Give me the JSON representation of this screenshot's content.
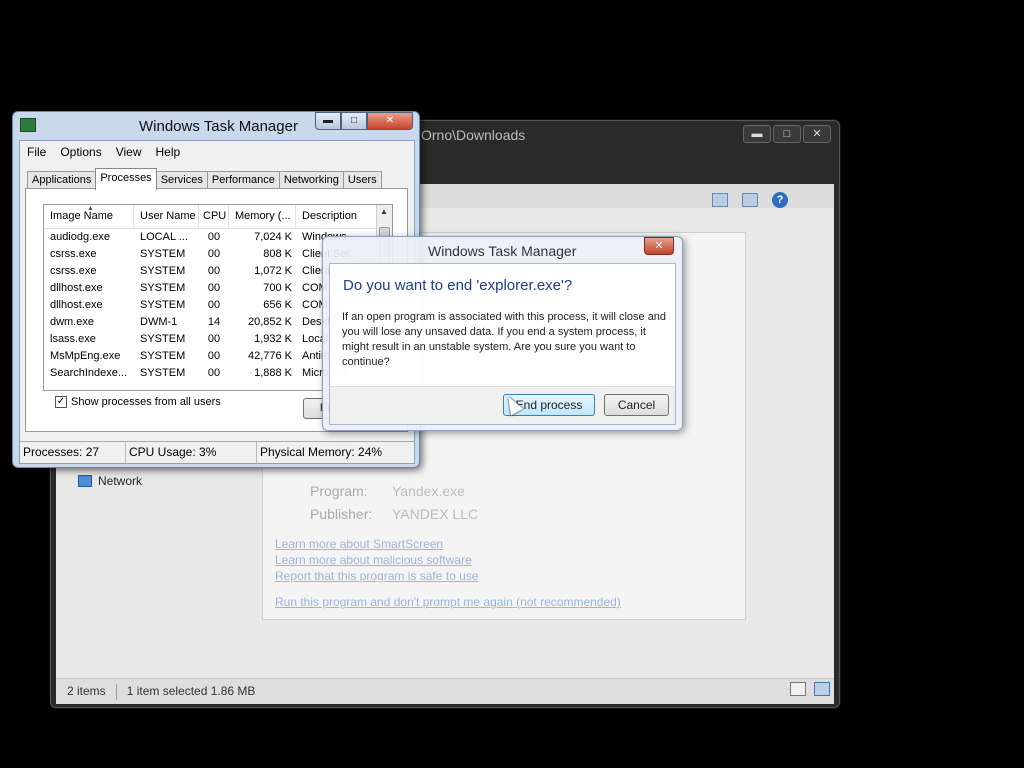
{
  "explorer": {
    "title": "Orno\\Downloads",
    "nav_network": "Network",
    "status_items": "2 items",
    "status_selected": "1 item selected  1.86 MB",
    "help_glyph": "?",
    "controls": {
      "min": "▬",
      "max": "□",
      "close": "✕"
    }
  },
  "smartscreen": {
    "program_label": "Program:",
    "program_value": "Yandex.exe",
    "publisher_label": "Publisher:",
    "publisher_value": "YANDEX LLC",
    "links": [
      "Learn more about SmartScreen",
      "Learn more about malicious software",
      "Report that this program is safe to use",
      "Run this program and don't prompt me again (not recommended)"
    ]
  },
  "task_manager": {
    "title": "Windows Task Manager",
    "controls": {
      "min": "▬",
      "max": "□",
      "close": "✕"
    },
    "menu": [
      "File",
      "Options",
      "View",
      "Help"
    ],
    "tabs": [
      "Applications",
      "Processes",
      "Services",
      "Performance",
      "Networking",
      "Users"
    ],
    "active_tab": "Processes",
    "columns": [
      "Image Name",
      "User Name",
      "CPU",
      "Memory (...",
      "Description"
    ],
    "rows": [
      [
        "audiodg.exe",
        "LOCAL ...",
        "00",
        "7,024 K",
        "Windows ..."
      ],
      [
        "csrss.exe",
        "SYSTEM",
        "00",
        "808 K",
        "Client Ser..."
      ],
      [
        "csrss.exe",
        "SYSTEM",
        "00",
        "1,072 K",
        "Client Ser..."
      ],
      [
        "dllhost.exe",
        "SYSTEM",
        "00",
        "700 K",
        "COM Surr..."
      ],
      [
        "dllhost.exe",
        "SYSTEM",
        "00",
        "656 K",
        "COM Surr..."
      ],
      [
        "dwm.exe",
        "DWM-1",
        "14",
        "20,852 K",
        "Desktop ..."
      ],
      [
        "lsass.exe",
        "SYSTEM",
        "00",
        "1,932 K",
        "Local Sec..."
      ],
      [
        "MsMpEng.exe",
        "SYSTEM",
        "00",
        "42,776 K",
        "Antimal..."
      ],
      [
        "SearchIndexe...",
        "SYSTEM",
        "00",
        "1,888 K",
        "Microsoft ..."
      ]
    ],
    "show_all_label": "Show processes from all users",
    "show_all_checked": true,
    "end_process_label": "End Process",
    "status": {
      "processes": "Processes: 27",
      "cpu": "CPU Usage: 3%",
      "memory": "Physical Memory: 24%"
    }
  },
  "dialog": {
    "title": "Windows Task Manager",
    "question": "Do you want to end 'explorer.exe'?",
    "message": "If an open program is associated with this process, it will close and you will lose any unsaved data. If you end a system process, it might result in an unstable system. Are you sure you want to continue?",
    "confirm_label": "End process",
    "cancel_label": "Cancel",
    "close_glyph": "✕"
  }
}
